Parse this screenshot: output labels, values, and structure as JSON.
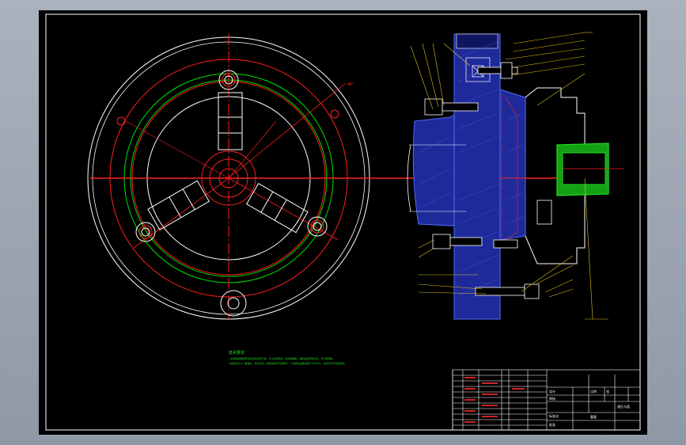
{
  "notes": {
    "heading": "技术要求",
    "line1": "1.夹具装配前所有零件必须清洗干净，不允许有毛刺、锐边等缺陷，装配后应转动灵活，无卡滞现象。",
    "line2": "2.装配后卡爪一致性好，定位可靠，夹紧后用手不能转动，工件装夹后跳动量不大于0.02，夹紧可靠不得有松动。"
  },
  "title_block": {
    "drawing_name": "液压卡盘",
    "scale_label": "比例",
    "sheet_label": "张",
    "designer_label": "设计",
    "checker_label": "审核",
    "standard_label": "标准化",
    "approve_label": "批准",
    "weight_label": "重量"
  },
  "colors": {
    "background": "#000000",
    "frame": "#ffffff",
    "circle_red": "#ff2020",
    "circle_green": "#00e000",
    "section_fill": "#1f2a9a",
    "section_line": "#4f6cff",
    "highlight_green": "#22dd22",
    "annotation": "#ff3030",
    "leader_yellow": "#e0c020"
  }
}
